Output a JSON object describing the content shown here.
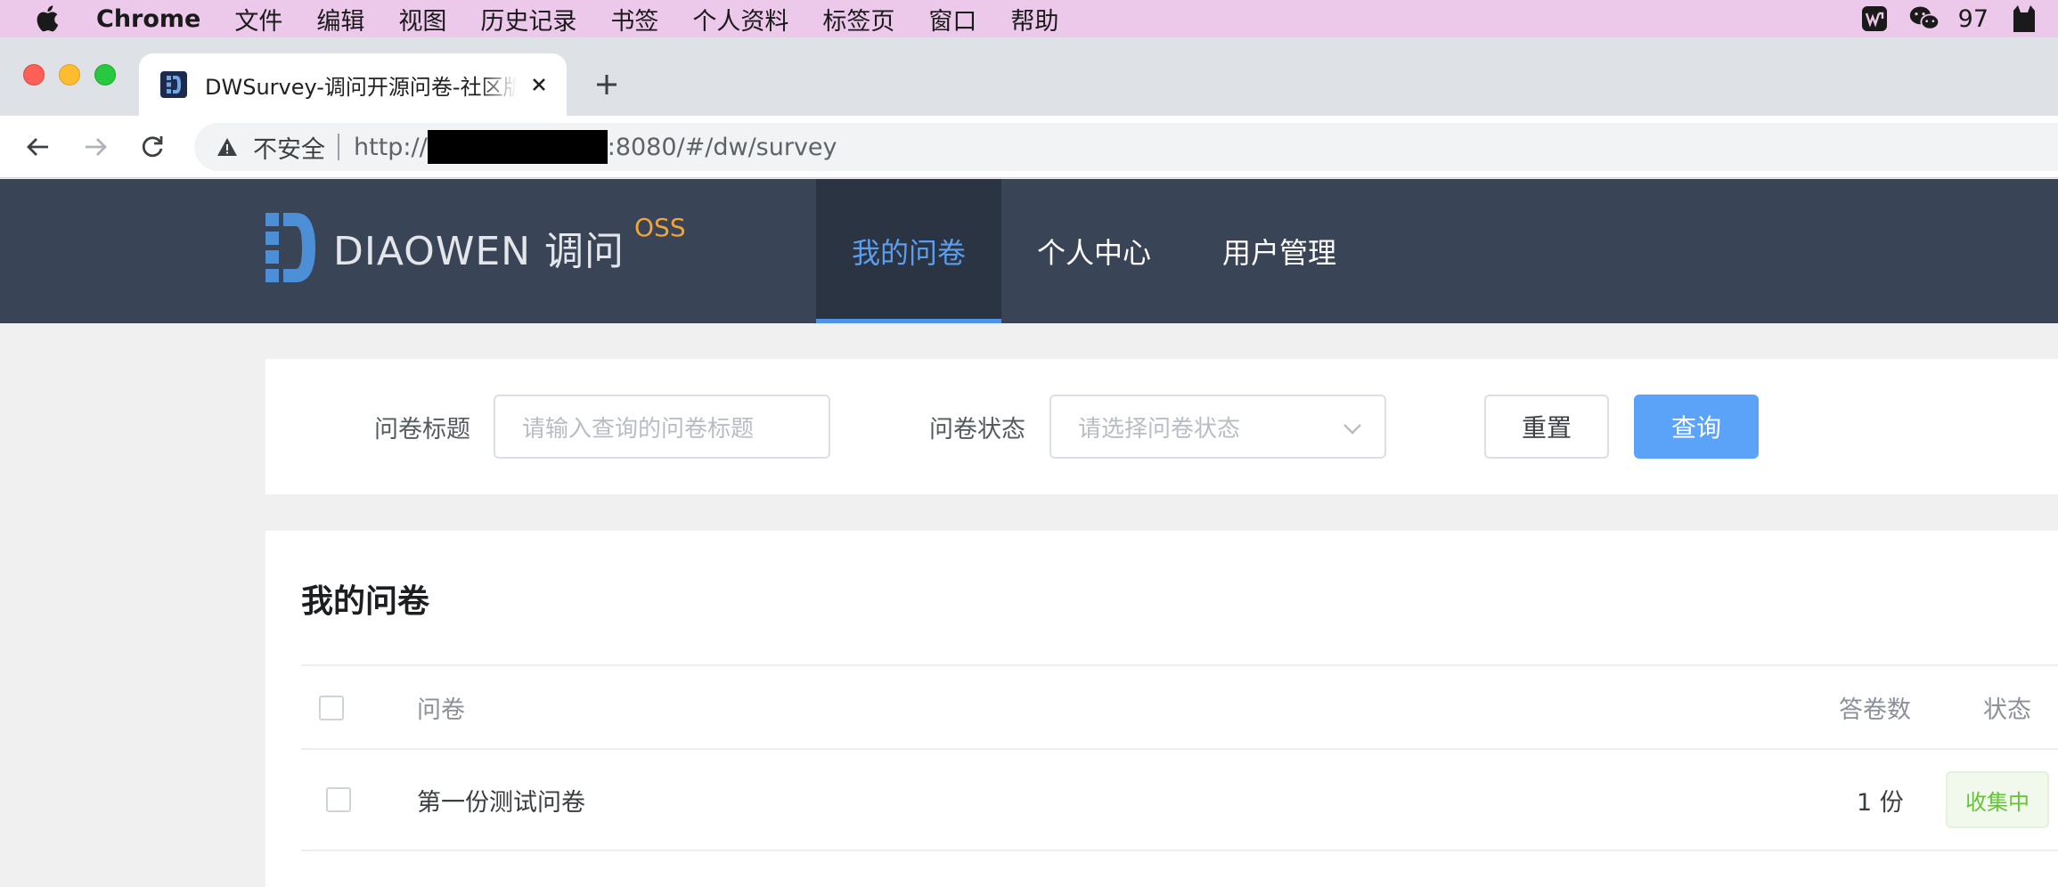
{
  "menubar": {
    "app_name": "Chrome",
    "items": [
      "文件",
      "编辑",
      "视图",
      "历史记录",
      "书签",
      "个人资料",
      "标签页",
      "窗口",
      "帮助"
    ],
    "tray_count": "97"
  },
  "browser": {
    "tab_title": "DWSurvey-调问开源问卷-社区版",
    "security_label": "不安全",
    "url_prefix": "http://",
    "url_suffix": ":8080/#/dw/survey"
  },
  "site": {
    "logo_text": "DIAOWEN 调问",
    "logo_badge": "OSS",
    "nav": [
      {
        "label": "我的问卷",
        "active": true
      },
      {
        "label": "个人中心",
        "active": false
      },
      {
        "label": "用户管理",
        "active": false
      }
    ]
  },
  "search": {
    "title_label": "问卷标题",
    "title_placeholder": "请输入查询的问卷标题",
    "status_label": "问卷状态",
    "status_placeholder": "请选择问卷状态",
    "reset_label": "重置",
    "query_label": "查询"
  },
  "list": {
    "title": "我的问卷",
    "columns": {
      "survey": "问卷",
      "answers": "答卷数",
      "status": "状态"
    },
    "rows": [
      {
        "name": "第一份测试问卷",
        "answers": "1 份",
        "status": "收集中"
      }
    ]
  },
  "colors": {
    "menubar_bg": "#ecc8ea",
    "header_bg": "#394456",
    "nav_active": "#5b9ef0",
    "primary_button": "#5ba3f8",
    "status_green": "#67c23a"
  }
}
